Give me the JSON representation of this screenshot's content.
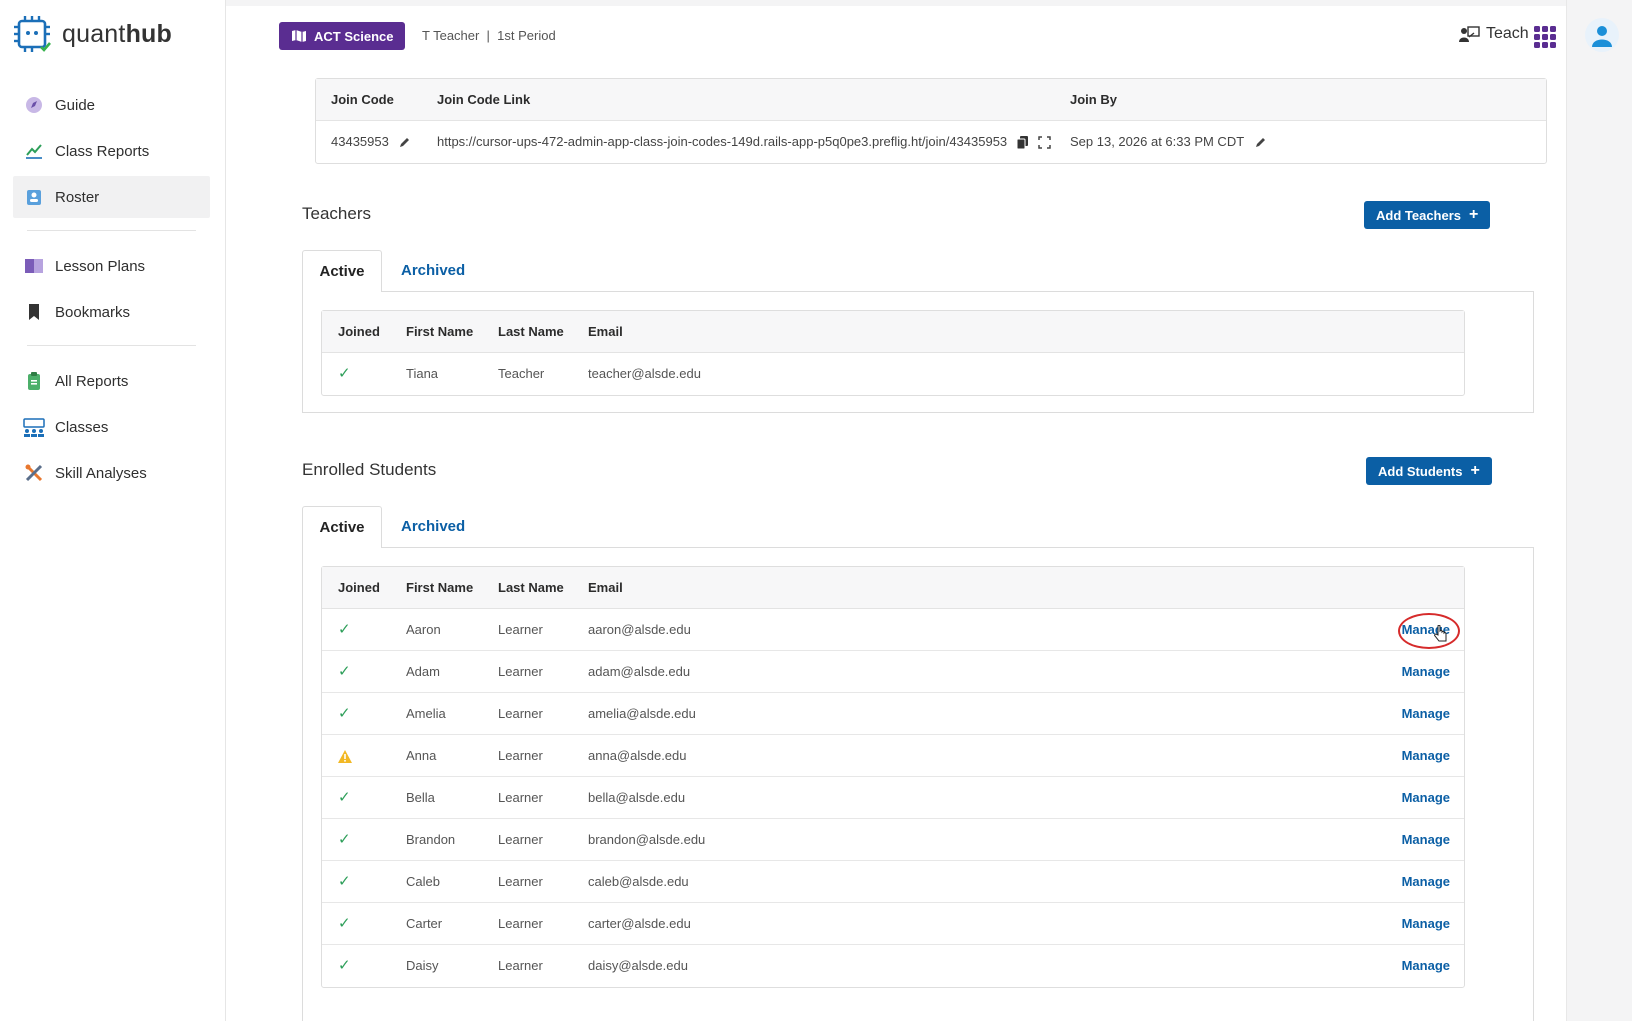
{
  "brand": {
    "name_regular": "quant",
    "name_bold": "hub"
  },
  "sidebar": {
    "groups": [
      [
        {
          "label": "Guide",
          "icon": "compass-icon",
          "active": false
        },
        {
          "label": "Class Reports",
          "icon": "line-chart-icon",
          "active": false
        },
        {
          "label": "Roster",
          "icon": "roster-icon",
          "active": true
        }
      ],
      [
        {
          "label": "Lesson Plans",
          "icon": "book-icon",
          "active": false
        },
        {
          "label": "Bookmarks",
          "icon": "bookmark-icon",
          "active": false
        }
      ],
      [
        {
          "label": "All Reports",
          "icon": "clipboard-icon",
          "active": false
        },
        {
          "label": "Classes",
          "icon": "classes-icon",
          "active": false
        },
        {
          "label": "Skill Analyses",
          "icon": "tools-icon",
          "active": false
        }
      ]
    ]
  },
  "header": {
    "course_label": "ACT Science",
    "breadcrumb": "T Teacher  |  1st Period",
    "teach_label": "Teach"
  },
  "join": {
    "headers": {
      "code": "Join Code",
      "link": "Join Code Link",
      "by": "Join By"
    },
    "code": "43435953",
    "link": "https://cursor-ups-472-admin-app-class-join-codes-149d.rails-app-p5q0pe3.preflig.ht/join/43435953",
    "by": "Sep 13, 2026 at 6:33 PM CDT"
  },
  "table_headers": {
    "joined": "Joined",
    "first": "First Name",
    "last": "Last Name",
    "email": "Email"
  },
  "teachers": {
    "title": "Teachers",
    "add_label": "Add Teachers",
    "tabs": {
      "active": "Active",
      "archived": "Archived"
    },
    "rows": [
      {
        "first": "Tiana",
        "last": "Teacher",
        "email": "teacher@alsde.edu",
        "status": "joined"
      }
    ]
  },
  "students": {
    "title": "Enrolled Students",
    "add_label": "Add Students",
    "tabs": {
      "active": "Active",
      "archived": "Archived"
    },
    "manage_label": "Manage",
    "rows": [
      {
        "first": "Aaron",
        "last": "Learner",
        "email": "aaron@alsde.edu",
        "status": "joined"
      },
      {
        "first": "Adam",
        "last": "Learner",
        "email": "adam@alsde.edu",
        "status": "joined"
      },
      {
        "first": "Amelia",
        "last": "Learner",
        "email": "amelia@alsde.edu",
        "status": "joined"
      },
      {
        "first": "Anna",
        "last": "Learner",
        "email": "anna@alsde.edu",
        "status": "warning"
      },
      {
        "first": "Bella",
        "last": "Learner",
        "email": "bella@alsde.edu",
        "status": "joined"
      },
      {
        "first": "Brandon",
        "last": "Learner",
        "email": "brandon@alsde.edu",
        "status": "joined"
      },
      {
        "first": "Caleb",
        "last": "Learner",
        "email": "caleb@alsde.edu",
        "status": "joined"
      },
      {
        "first": "Carter",
        "last": "Learner",
        "email": "carter@alsde.edu",
        "status": "joined"
      },
      {
        "first": "Daisy",
        "last": "Learner",
        "email": "daisy@alsde.edu",
        "status": "joined"
      }
    ]
  },
  "colors": {
    "primary": "#0b5fa5",
    "course": "#5a2d91",
    "check": "#2e9f5a",
    "warning": "#f2b824",
    "highlight": "#d62b2b"
  }
}
